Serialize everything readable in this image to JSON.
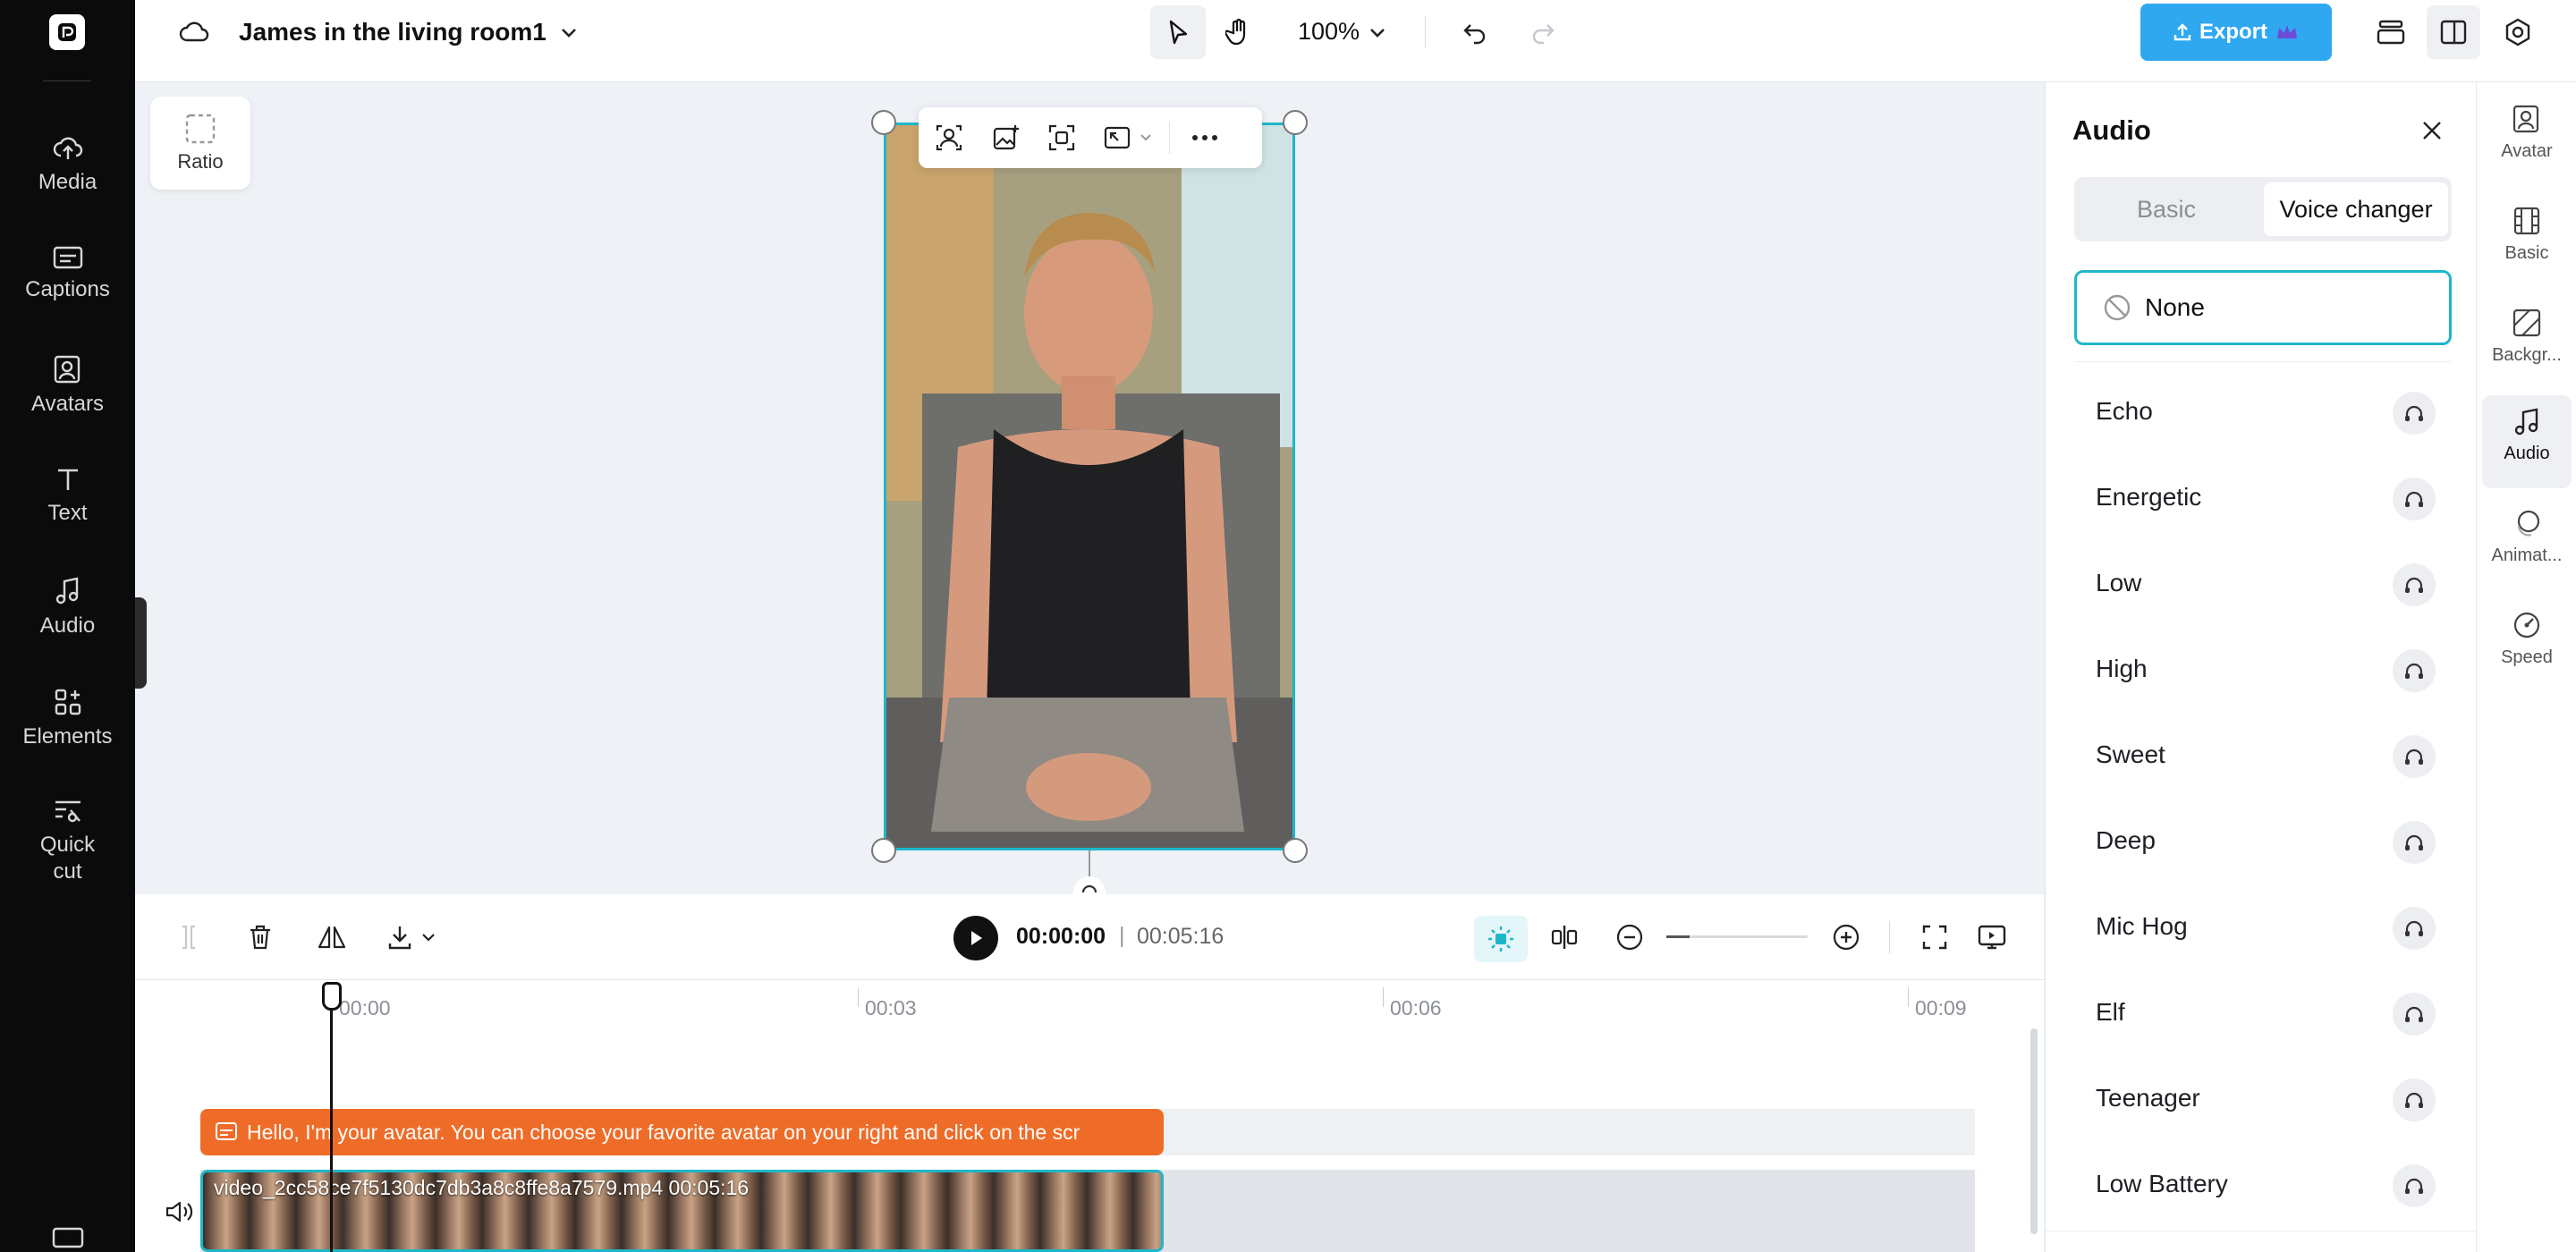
{
  "app": {
    "project_title": "James in the living room1",
    "zoom": "100%",
    "export_label": "Export"
  },
  "left_rail": [
    {
      "label": "Media"
    },
    {
      "label": "Captions"
    },
    {
      "label": "Avatars"
    },
    {
      "label": "Text"
    },
    {
      "label": "Audio"
    },
    {
      "label": "Elements"
    },
    {
      "label": "Quick cut"
    }
  ],
  "canvas": {
    "ratio_label": "Ratio"
  },
  "playback": {
    "current_time": "00:00:00",
    "separator": "|",
    "total_time": "00:05:16"
  },
  "timeline": {
    "ticks": [
      "00:00",
      "00:03",
      "00:06",
      "00:09"
    ],
    "caption_text": "Hello, I'm your avatar. You can choose your favorite avatar on your right and click on the scr",
    "video_clip_label": "video_2cc58ce7f5130dc7db3a8c8ffe8a7579.mp4   00:05:16"
  },
  "audio_panel": {
    "title": "Audio",
    "tabs": {
      "basic": "Basic",
      "voice_changer": "Voice changer"
    },
    "selected_option": "None",
    "voices": [
      "Echo",
      "Energetic",
      "Low",
      "High",
      "Sweet",
      "Deep",
      "Mic Hog",
      "Elf",
      "Teenager",
      "Low Battery"
    ]
  },
  "right_rail": [
    {
      "label": "Avatar"
    },
    {
      "label": "Basic"
    },
    {
      "label": "Backgr..."
    },
    {
      "label": "Audio"
    },
    {
      "label": "Animat..."
    },
    {
      "label": "Speed"
    }
  ],
  "colors": {
    "accent": "#1fb6c9",
    "export": "#2fa8f0",
    "caption_clip": "#ef6c28",
    "rail_bg": "#0b0b0c"
  }
}
